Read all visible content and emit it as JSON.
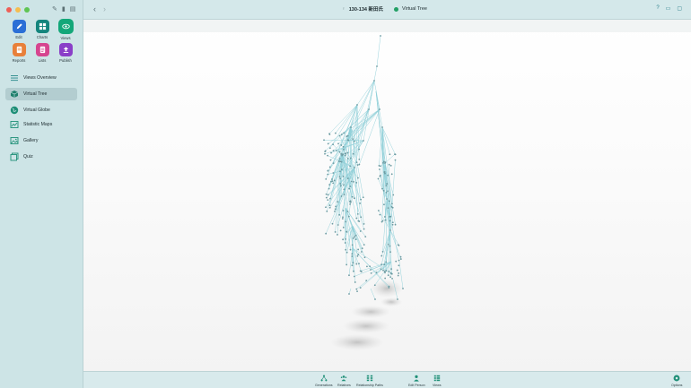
{
  "sidebar": {
    "apps": [
      {
        "label": "Edit",
        "icon": "pencil-icon",
        "color": "#2b6fd6"
      },
      {
        "label": "Charts",
        "icon": "charts-icon",
        "color": "#14857d"
      },
      {
        "label": "Views",
        "icon": "eye-icon",
        "color": "#13a779"
      },
      {
        "label": "Reports",
        "icon": "reports-icon",
        "color": "#e8803a"
      },
      {
        "label": "Lists",
        "icon": "lists-icon",
        "color": "#d6458f"
      },
      {
        "label": "Publish",
        "icon": "publish-icon",
        "color": "#8a3fc8"
      }
    ],
    "nav": [
      {
        "label": "Views Overview",
        "icon": "list-icon"
      },
      {
        "label": "Virtual Tree",
        "icon": "cube-icon",
        "active": true
      },
      {
        "label": "Virtual Globe",
        "icon": "globe-icon"
      },
      {
        "label": "Statistic Maps",
        "icon": "map-icon"
      },
      {
        "label": "Gallery",
        "icon": "gallery-icon"
      },
      {
        "label": "Quiz",
        "icon": "quiz-icon"
      }
    ]
  },
  "titlebar": {
    "gender_symbol": "♀",
    "person": "130-134 新田氏",
    "view_name": "Virtual Tree"
  },
  "bottombar": {
    "buttons": [
      {
        "label": "Generations",
        "icon": "generations-icon"
      },
      {
        "label": "Relatives",
        "icon": "relatives-icon"
      },
      {
        "label": "Relationship Paths",
        "icon": "relationship-paths-icon"
      },
      {
        "label": "Edit Person",
        "icon": "person-icon"
      },
      {
        "label": "Views",
        "icon": "views-grid-icon"
      },
      {
        "label": "Options",
        "icon": "options-icon"
      }
    ]
  },
  "colors": {
    "accent": "#2a9d8f",
    "sidebar_bg": "#cde4e6",
    "tree_line": "#7fc4cf",
    "tree_node": "#5f8f96"
  }
}
